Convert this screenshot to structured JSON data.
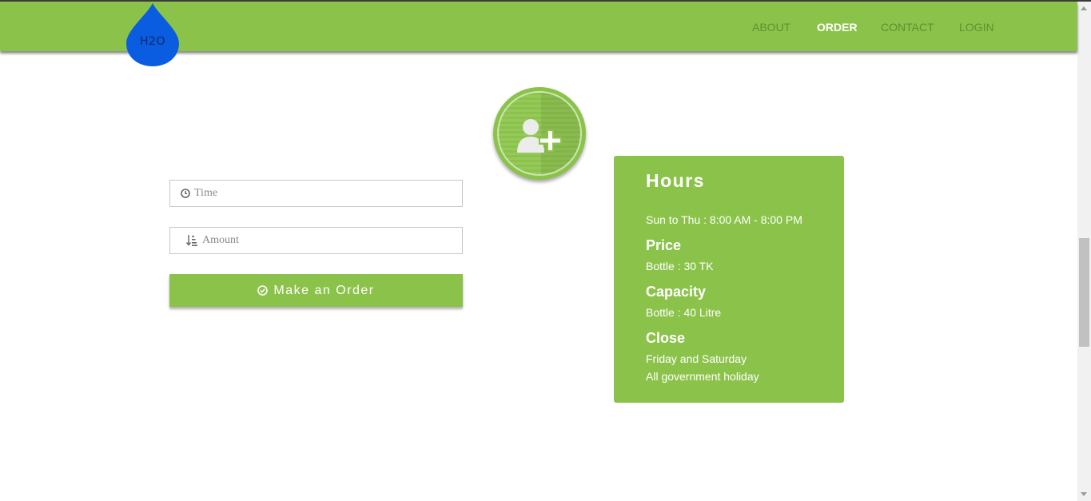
{
  "logo": {
    "text": "H2O",
    "color": "#0a5ce0"
  },
  "nav": {
    "items": [
      {
        "label": "ABOUT",
        "active": false
      },
      {
        "label": "ORDER",
        "active": true
      },
      {
        "label": "CONTACT",
        "active": false
      },
      {
        "label": "LOGIN",
        "active": false
      }
    ]
  },
  "badge": {
    "icon": "add-user-icon"
  },
  "form": {
    "time": {
      "placeholder": "Time",
      "value": "",
      "icon": "clock-icon"
    },
    "amount": {
      "placeholder": "Amount",
      "value": "",
      "icon": "sort-amount-icon"
    },
    "submit": {
      "label": "Make an Order",
      "icon": "check-circle-icon"
    }
  },
  "hours_card": {
    "title": "Hours",
    "schedule": "Sun to Thu : 8:00 AM - 8:00 PM",
    "price_heading": "Price",
    "price": "Bottle : 30 TK",
    "capacity_heading": "Capacity",
    "capacity": "Bottle : 40 Litre",
    "close_heading": "Close",
    "close_days": "Friday and Saturday",
    "close_holiday": "All government holiday"
  },
  "colors": {
    "accent": "#8bc34a",
    "nav_text": "#5f8f33",
    "drop": "#0a5ce0"
  }
}
